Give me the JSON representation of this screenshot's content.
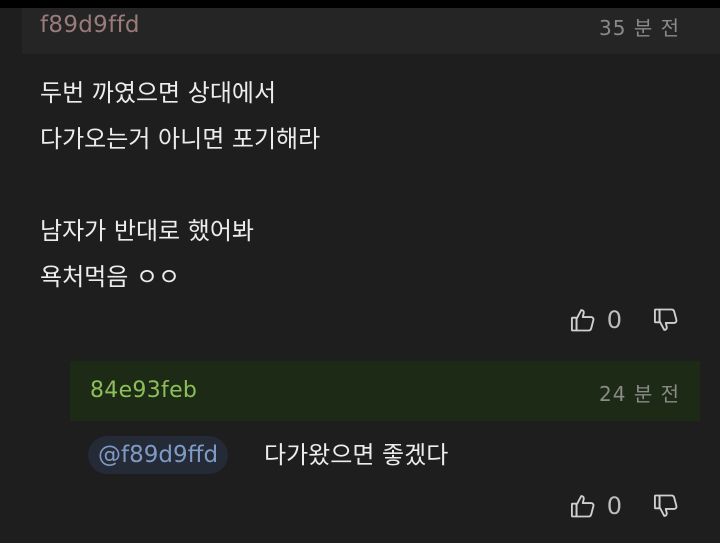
{
  "comment": {
    "author": "f89d9ffd",
    "time": "35 분 전",
    "lines": [
      "두번 까였으면 상대에서",
      "다가오는거 아니면 포기해라",
      "",
      "남자가 반대로 했어봐",
      "욕처먹음 ㅇㅇ"
    ],
    "like_count": "0"
  },
  "reply": {
    "author": "84e93feb",
    "time": "24 분 전",
    "mention": "@f89d9ffd",
    "text": "다가왔으면 좋겠다",
    "like_count": "0"
  },
  "icons": {
    "like": "thumbs-up-icon",
    "dislike": "thumbs-down-icon"
  },
  "colors": {
    "background": "#1e1e1e",
    "author1": "#9a7b7b",
    "author2": "#8cbf5a",
    "mention": "#7f9ac6",
    "reply_header": "#1c2a16"
  }
}
